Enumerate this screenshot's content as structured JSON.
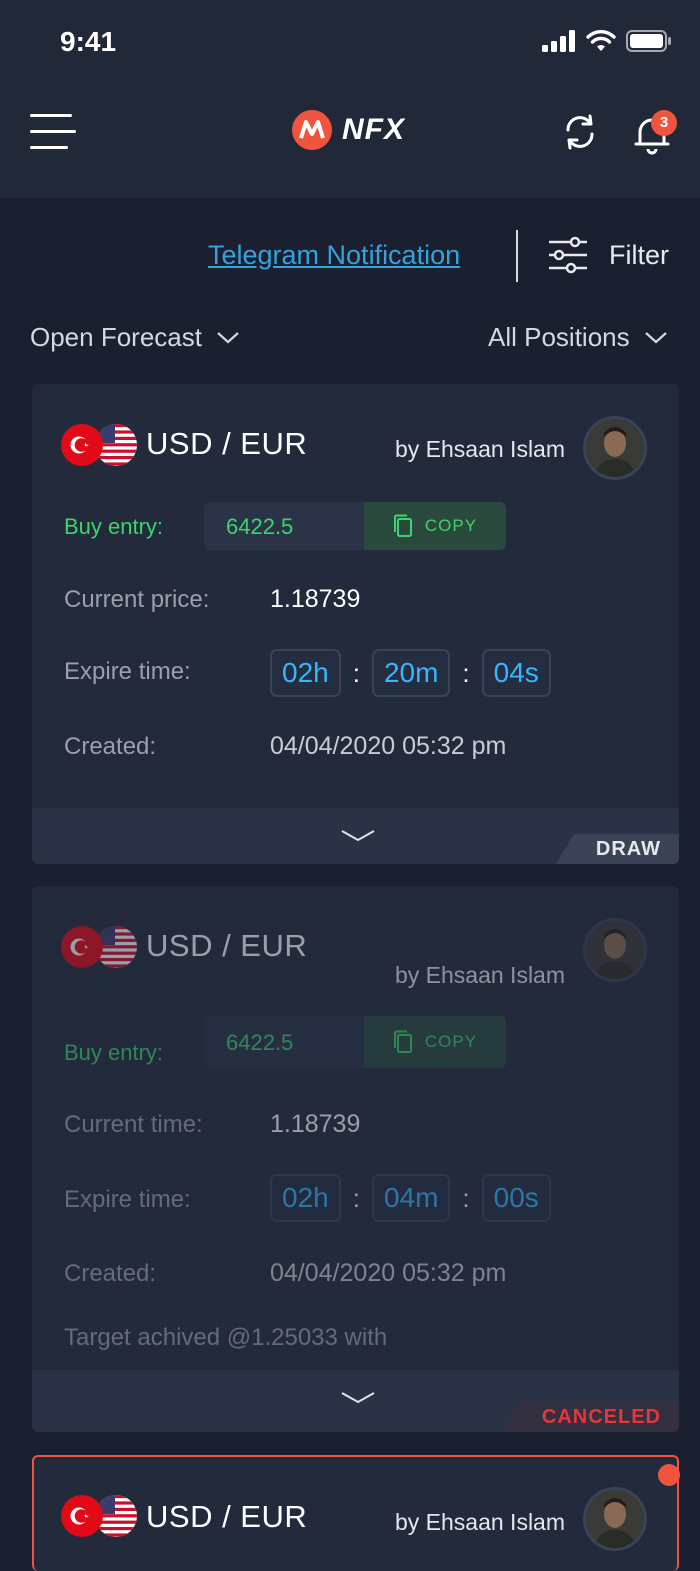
{
  "status_bar": {
    "time": "9:41"
  },
  "header": {
    "logo_text": "NFX",
    "notification_count": "3"
  },
  "toolbar": {
    "telegram_link": "Telegram Notification",
    "filter_label": "Filter"
  },
  "dropdowns": {
    "left": "Open Forecast",
    "right": "All Positions"
  },
  "colors": {
    "accent": "#f0543c",
    "green": "#3dd46d",
    "blue": "#35b7ff",
    "link": "#36a2dc"
  },
  "cards": [
    {
      "pair": "USD / EUR",
      "author": "by Ehsaan Islam",
      "buy_label": "Buy entry:",
      "entry_value": "6422.5",
      "copy_label": "COPY",
      "price_label": "Current price:",
      "price_value": "1.18739",
      "expire_label": "Expire time:",
      "timer_h": "02h",
      "timer_m": "20m",
      "timer_s": "04s",
      "timer_sep": ":",
      "created_label": "Created:",
      "created_value": "04/04/2020 05:32 pm",
      "status": "DRAW"
    },
    {
      "pair": "USD / EUR",
      "author": "by Ehsaan Islam",
      "buy_label": "Buy entry:",
      "entry_value": "6422.5",
      "copy_label": "COPY",
      "price_label": "Current time:",
      "price_value": "1.18739",
      "expire_label": "Expire time:",
      "timer_h": "02h",
      "timer_m": "04m",
      "timer_s": "00s",
      "timer_sep": ":",
      "created_label": "Created:",
      "created_value": "04/04/2020 05:32 pm",
      "target_text": "Target achived @1.25033 with",
      "status": "CANCELED"
    },
    {
      "pair": "USD / EUR",
      "author": "by Ehsaan Islam"
    }
  ]
}
